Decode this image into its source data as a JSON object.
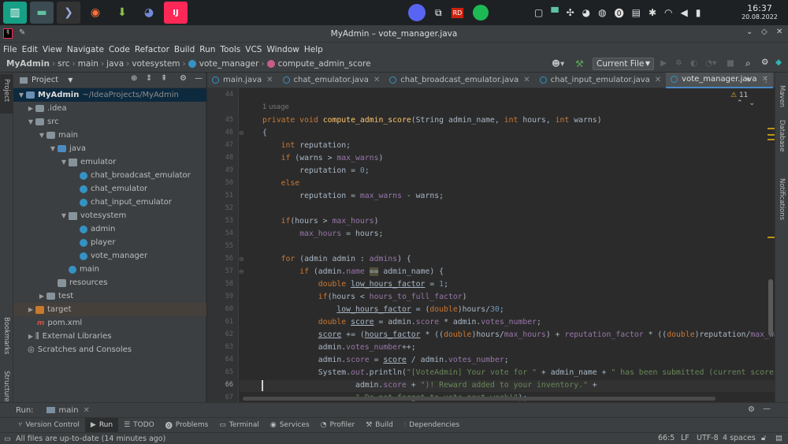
{
  "taskbar": {
    "time": "16:37",
    "date": "20.08.2022"
  },
  "window": {
    "title": "MyAdmin – vote_manager.java"
  },
  "menu": [
    "File",
    "Edit",
    "View",
    "Navigate",
    "Code",
    "Refactor",
    "Build",
    "Run",
    "Tools",
    "VCS",
    "Window",
    "Help"
  ],
  "breadcrumb": [
    "MyAdmin",
    "src",
    "main",
    "java",
    "votesystem",
    "vote_manager",
    "compute_admin_score"
  ],
  "toolbar": {
    "run_config": "Current File"
  },
  "project_panel": {
    "title": "Project",
    "tree": [
      {
        "label": "MyAdmin",
        "extra": "~/IdeaProjects/MyAdmin",
        "kind": "module"
      },
      {
        "label": ".idea",
        "kind": "folder"
      },
      {
        "label": "src",
        "kind": "folder"
      },
      {
        "label": "main",
        "kind": "folder"
      },
      {
        "label": "java",
        "kind": "folder"
      },
      {
        "label": "emulator",
        "kind": "package"
      },
      {
        "label": "chat_broadcast_emulator",
        "kind": "class"
      },
      {
        "label": "chat_emulator",
        "kind": "class"
      },
      {
        "label": "chat_input_emulator",
        "kind": "class"
      },
      {
        "label": "votesystem",
        "kind": "package"
      },
      {
        "label": "admin",
        "kind": "class"
      },
      {
        "label": "player",
        "kind": "class"
      },
      {
        "label": "vote_manager",
        "kind": "class"
      },
      {
        "label": "main",
        "kind": "class"
      },
      {
        "label": "resources",
        "kind": "folder"
      },
      {
        "label": "test",
        "kind": "folder"
      },
      {
        "label": "target",
        "kind": "folder"
      },
      {
        "label": "pom.xml",
        "kind": "file"
      },
      {
        "label": "External Libraries",
        "kind": "lib"
      },
      {
        "label": "Scratches and Consoles",
        "kind": "scratch"
      }
    ]
  },
  "tabs": [
    "main.java",
    "chat_emulator.java",
    "chat_broadcast_emulator.java",
    "chat_input_emulator.java",
    "vote_manager.java",
    "pla"
  ],
  "editor": {
    "usages": "1 usage",
    "warnings": "11",
    "line_numbers": [
      "44",
      "45",
      "46",
      "47",
      "48",
      "49",
      "50",
      "51",
      "52",
      "53",
      "54",
      "55",
      "56",
      "57",
      "58",
      "59",
      "60",
      "61",
      "62",
      "63",
      "64",
      "65",
      "66",
      "67"
    ]
  },
  "left_strip": [
    "Project",
    "Bookmarks",
    "Structure"
  ],
  "right_strip": [
    "Maven",
    "Database",
    "Notifications"
  ],
  "run_bar": {
    "label": "Run:",
    "tab": "main"
  },
  "tool_windows": [
    "Version Control",
    "Run",
    "TODO",
    "Problems",
    "Terminal",
    "Services",
    "Profiler",
    "Build",
    "Dependencies"
  ],
  "status": {
    "message": "All files are up-to-date (14 minutes ago)",
    "position": "66:5",
    "line_sep": "LF",
    "encoding": "UTF-8",
    "indent": "4 spaces"
  }
}
